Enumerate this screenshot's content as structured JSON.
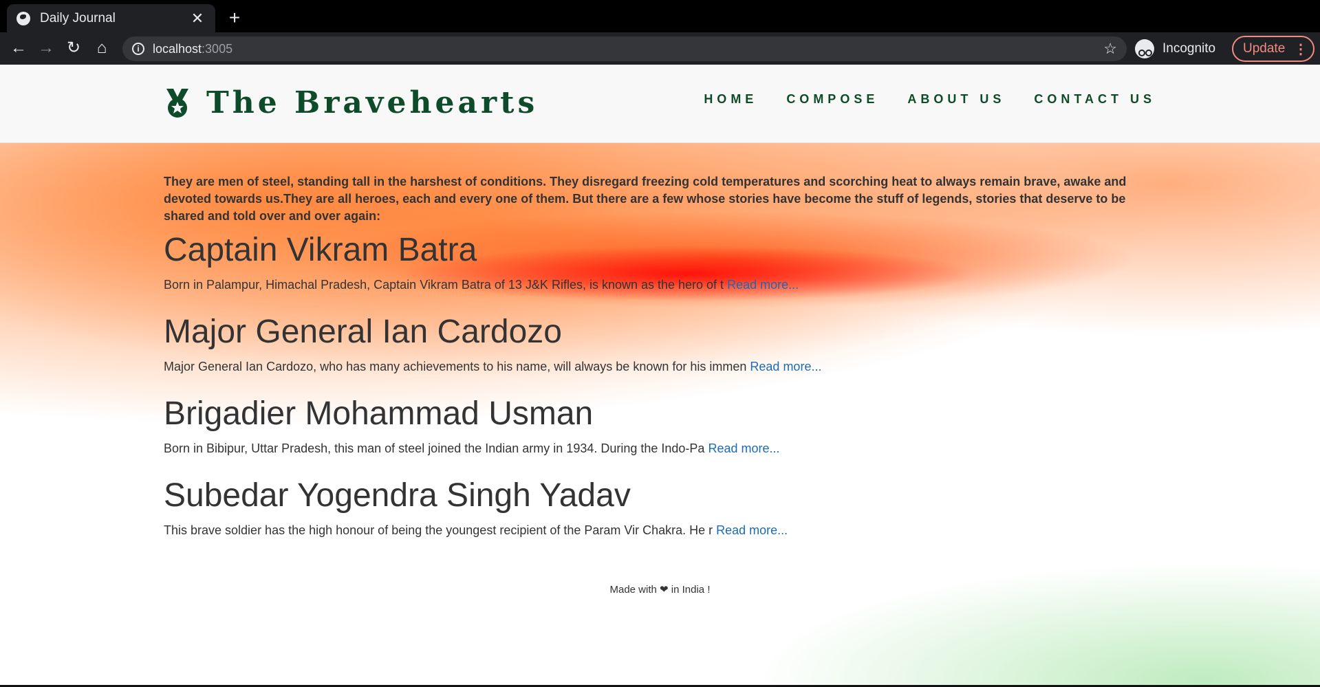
{
  "browser": {
    "tab_title": "Daily Journal",
    "tab_close": "✕",
    "new_tab": "+",
    "url_host": "localhost",
    "url_port": ":3005",
    "incognito_label": "Incognito",
    "update_label": "Update",
    "icons": [
      "globe-icon",
      "back-arrow-icon",
      "forward-arrow-icon",
      "reload-icon",
      "home-icon",
      "info-icon",
      "star-icon",
      "incognito-icon",
      "more-dots-icon"
    ]
  },
  "site": {
    "brand": "The Bravehearts",
    "nav": [
      "HOME",
      "COMPOSE",
      "ABOUT US",
      "CONTACT US"
    ],
    "brand_color": "#0d4b2a",
    "link_color": "#1a6bb8"
  },
  "intro": "They are men of steel, standing tall in the harshest of conditions. They disregard freezing cold temperatures and scorching heat to always remain brave, awake and devoted towards us.They are all heroes, each and every one of them. But there are a few whose stories have become the stuff of legends, stories that deserve to be shared and told over and over again:",
  "posts": [
    {
      "title": "Captain Vikram Batra",
      "excerpt": "Born in Palampur, Himachal Pradesh, Captain Vikram Batra of 13 J&K Rifles, is known as the hero of t",
      "link": "Read more..."
    },
    {
      "title": "Major General Ian Cardozo",
      "excerpt": "Major General Ian Cardozo, who has many achievements to his name, will always be known for his immen",
      "link": "Read more..."
    },
    {
      "title": "Brigadier Mohammad Usman",
      "excerpt": "Born in Bibipur, Uttar Pradesh, this man of steel joined the Indian army in 1934. During the Indo-Pa",
      "link": "Read more..."
    },
    {
      "title": "Subedar Yogendra Singh Yadav",
      "excerpt": "This brave soldier has the high honour of being the youngest recipient of the Param Vir Chakra. He r",
      "link": "Read more..."
    }
  ],
  "footer": {
    "before": "Made with",
    "heart": "❤",
    "after": "in India !"
  }
}
